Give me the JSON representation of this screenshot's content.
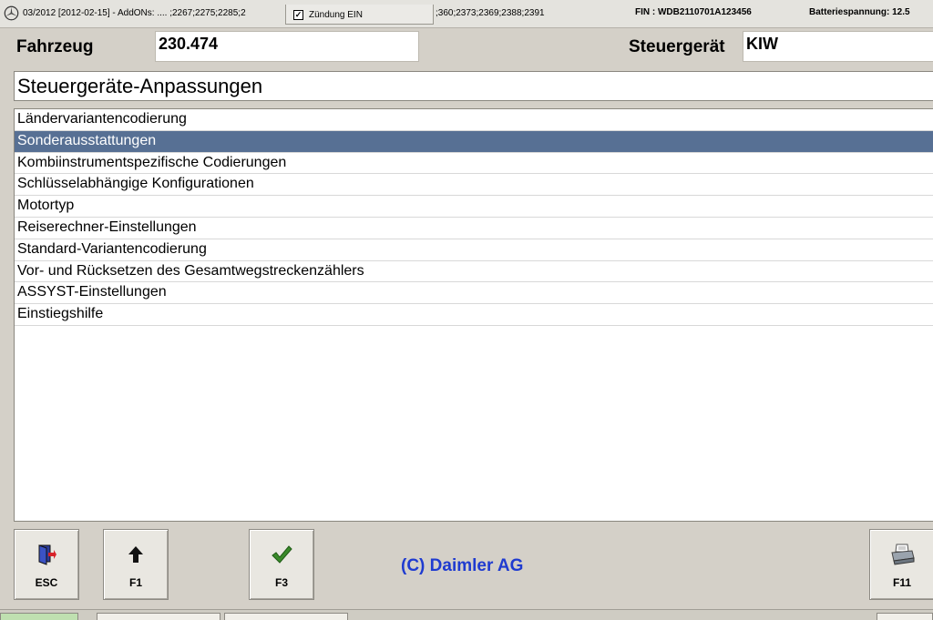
{
  "topbar": {
    "version_text": "03/2012 [2012-02-15] - AddONs:  .... ;2267;2275;2285;2",
    "addons_tail": ";360;2373;2369;2388;2391",
    "fin": "FIN : WDB2110701A123456",
    "battery": "Batteriespannung: 12.5",
    "ignition_label": "Zündung EIN",
    "ignition_checked": true
  },
  "header": {
    "vehicle_label": "Fahrzeug",
    "vehicle_value": "230.474",
    "ecu_label": "Steuergerät",
    "ecu_value": "KIW"
  },
  "title": "Steuergeräte-Anpassungen",
  "list": {
    "selected_index": 1,
    "items": [
      "Ländervariantencodierung",
      "Sonderausstattungen",
      "Kombiinstrumentspezifische Codierungen",
      "Schlüsselabhängige Konfigurationen",
      "Motortyp",
      "Reiserechner-Einstellungen",
      "Standard-Variantencodierung",
      "Vor- und Rücksetzen des Gesamtwegstreckenzählers",
      "ASSYST-Einstellungen",
      "Einstiegshilfe"
    ]
  },
  "buttons": {
    "esc": {
      "label": "ESC",
      "icon": "exit-door-icon"
    },
    "f1": {
      "label": "F1",
      "icon": "arrow-up-icon"
    },
    "f3": {
      "label": "F3",
      "icon": "checkmark-icon"
    },
    "f11": {
      "label": "F11",
      "icon": "printer-icon"
    }
  },
  "copyright": "(C) Daimler AG",
  "colors": {
    "selection": "#577094",
    "copyright_text": "#1f3bd0",
    "checkmark": "#3a8a2a"
  }
}
